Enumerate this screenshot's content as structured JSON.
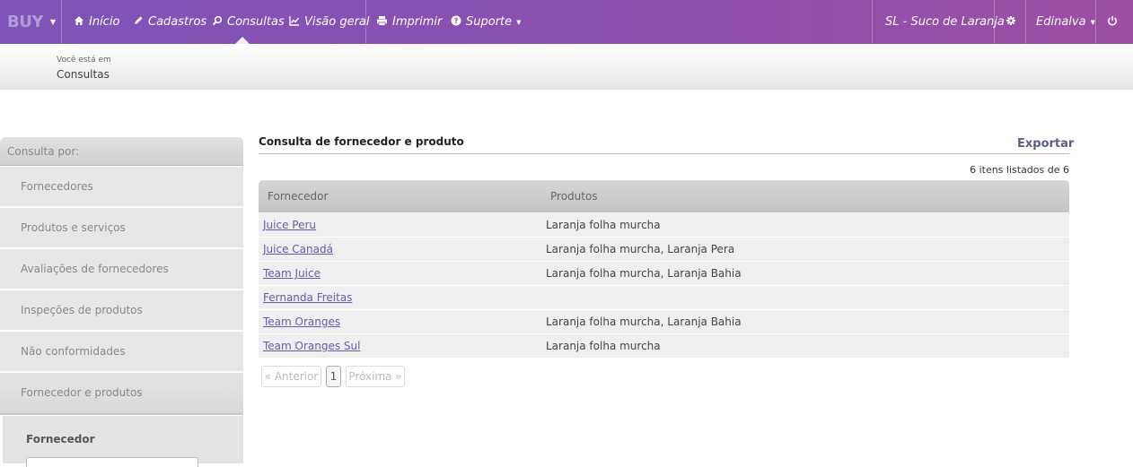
{
  "navbar": {
    "brand": "BUY",
    "items": [
      {
        "label": "Início",
        "icon": "home-icon"
      },
      {
        "label": "Cadastros",
        "icon": "pencil-icon"
      },
      {
        "label": "Consultas",
        "icon": "search-icon"
      },
      {
        "label": "Visão geral",
        "icon": "chart-icon"
      },
      {
        "label": "Imprimir",
        "icon": "printer-icon"
      },
      {
        "label": "Suporte",
        "icon": "help-icon"
      }
    ],
    "company": "SL - Suco de Laranja",
    "user": "Edinalva",
    "accent_color": "#8a4fb0"
  },
  "breadcrumb": {
    "prefix": "Você está em",
    "current": "Consultas"
  },
  "sidebar": {
    "header": "Consulta por:",
    "items": [
      {
        "label": "Fornecedores"
      },
      {
        "label": "Produtos e serviços"
      },
      {
        "label": "Avaliações de fornecedores"
      },
      {
        "label": "Inspeções de produtos"
      },
      {
        "label": "Não conformidades"
      },
      {
        "label": "Fornecedor e produtos",
        "active": true
      }
    ],
    "filter_label": "Fornecedor"
  },
  "main": {
    "title": "Consulta de fornecedor e produto",
    "export_label": "Exportar",
    "count_text": "6 itens listados de 6",
    "columns": [
      "Fornecedor",
      "Produtos"
    ],
    "rows": [
      {
        "fornecedor": "Juice Peru",
        "produtos": "Laranja folha murcha"
      },
      {
        "fornecedor": "Juice Canadá",
        "produtos": "Laranja folha murcha, Laranja Pera"
      },
      {
        "fornecedor": "Team Juice",
        "produtos": "Laranja folha murcha, Laranja Bahia"
      },
      {
        "fornecedor": "Fernanda Freitas",
        "produtos": ""
      },
      {
        "fornecedor": "Team Oranges",
        "produtos": "Laranja folha murcha, Laranja Bahia"
      },
      {
        "fornecedor": "Team Oranges Sul",
        "produtos": "Laranja folha murcha"
      }
    ],
    "pagination": {
      "prev": "« Anterior",
      "current": "1",
      "next": "Próxima »"
    }
  }
}
